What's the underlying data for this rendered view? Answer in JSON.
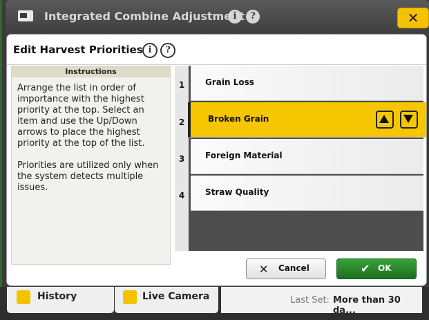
{
  "outer_window": {
    "title": "Integrated Combine Adjustment 2",
    "close_label": "✕"
  },
  "dialog": {
    "title": "Edit Harvest Priorities",
    "instructions": {
      "heading": "Instructions",
      "paragraph_1": "Arrange the list in order of importance with the highest priority at the top. Select an item and use the Up/Down arrows to place the highest priority at the top of the list.",
      "paragraph_2": "Priorities are utilized only when the system detects multiple issues."
    },
    "priorities": [
      {
        "rank": "1",
        "label": "Grain Loss",
        "selected": false
      },
      {
        "rank": "2",
        "label": "Broken Grain",
        "selected": true
      },
      {
        "rank": "3",
        "label": "Foreign Material",
        "selected": false
      },
      {
        "rank": "4",
        "label": "Straw Quality",
        "selected": false
      }
    ],
    "buttons": {
      "cancel_label": "Cancel",
      "ok_label": "OK"
    }
  },
  "bottom_bar": {
    "history_label": "History",
    "camera_label": "Live Camera",
    "last_set_label": "Last Set:",
    "last_set_value": "More than 30 da..."
  },
  "colors": {
    "accent_yellow": "#f6c700",
    "ok_green": "#2e8b2e",
    "title_bar": "#4a4a4a"
  },
  "icons": [
    "app-icon",
    "info-icon",
    "help-icon",
    "close-icon",
    "up-arrow-icon",
    "down-arrow-icon",
    "cancel-x-icon",
    "ok-check-icon",
    "history-icon",
    "camera-icon"
  ]
}
